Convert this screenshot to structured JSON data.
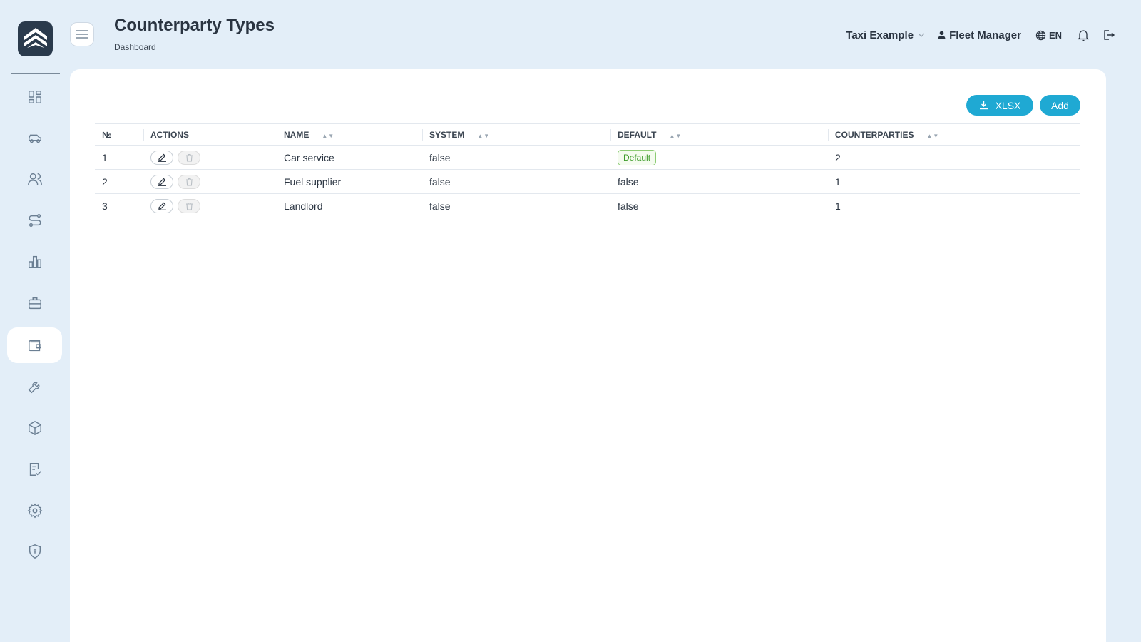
{
  "header": {
    "title": "Counterparty Types",
    "breadcrumb": "Dashboard",
    "company": "Taxi Example",
    "user": "Fleet Manager",
    "language": "EN"
  },
  "sidebar": {
    "items": [
      {
        "icon": "dashboard-icon"
      },
      {
        "icon": "car-icon"
      },
      {
        "icon": "users-icon"
      },
      {
        "icon": "route-icon"
      },
      {
        "icon": "bar-chart-icon"
      },
      {
        "icon": "briefcase-icon"
      },
      {
        "icon": "wallet-icon",
        "active": true
      },
      {
        "icon": "wrench-icon"
      },
      {
        "icon": "box-icon"
      },
      {
        "icon": "checklist-icon"
      },
      {
        "icon": "gear-icon"
      },
      {
        "icon": "shield-icon"
      }
    ]
  },
  "toolbar": {
    "xlsx_label": "XLSX",
    "add_label": "Add"
  },
  "table": {
    "columns": [
      "№",
      "ACTIONS",
      "NAME",
      "SYSTEM",
      "DEFAULT",
      "COUNTERPARTIES"
    ],
    "rows": [
      {
        "no": "1",
        "name": "Car service",
        "system": "false",
        "default": "Default",
        "default_is_badge": true,
        "counterparties": "2"
      },
      {
        "no": "2",
        "name": "Fuel supplier",
        "system": "false",
        "default": "false",
        "default_is_badge": false,
        "counterparties": "1"
      },
      {
        "no": "3",
        "name": "Landlord",
        "system": "false",
        "default": "false",
        "default_is_badge": false,
        "counterparties": "1"
      }
    ]
  },
  "colors": {
    "accent": "#1fa9d3",
    "background": "#e3eef8",
    "badge_green": "#3d9b2a"
  }
}
